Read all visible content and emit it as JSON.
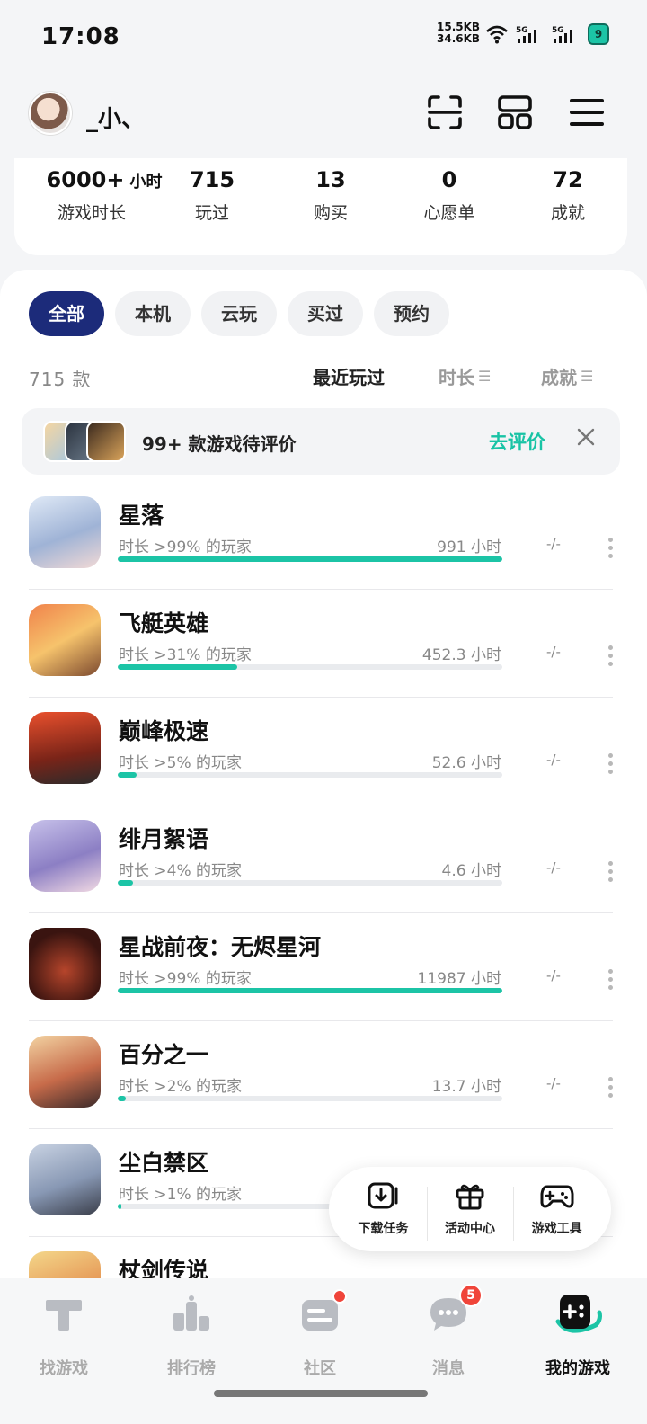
{
  "status_bar": {
    "time": "17:08",
    "net_up": "15.5KB",
    "net_down": "34.6KB",
    "battery": "9"
  },
  "profile": {
    "username": "_小、"
  },
  "stats": [
    {
      "value": "6000+",
      "unit": "小时",
      "label": "游戏时长"
    },
    {
      "value": "715",
      "unit": "",
      "label": "玩过"
    },
    {
      "value": "13",
      "unit": "",
      "label": "购买"
    },
    {
      "value": "0",
      "unit": "",
      "label": "心愿单"
    },
    {
      "value": "72",
      "unit": "",
      "label": "成就"
    }
  ],
  "filters": [
    "全部",
    "本机",
    "云玩",
    "买过",
    "预约"
  ],
  "list_header": {
    "count": "715 款",
    "sort_recent": "最近玩过",
    "sort_duration": "时长",
    "sort_achievement": "成就"
  },
  "review_banner": {
    "text": "99+ 款游戏待评价",
    "link": "去评价"
  },
  "games": [
    {
      "title": "星落",
      "pct": "时长 >99% 的玩家",
      "hours": "991 小时",
      "progress": 1.0,
      "score": "-/-"
    },
    {
      "title": "飞艇英雄",
      "pct": "时长 >31% 的玩家",
      "hours": "452.3 小时",
      "progress": 0.31,
      "score": "-/-"
    },
    {
      "title": "巅峰极速",
      "pct": "时长 >5% 的玩家",
      "hours": "52.6 小时",
      "progress": 0.05,
      "score": "-/-"
    },
    {
      "title": "绯月絮语",
      "pct": "时长 >4% 的玩家",
      "hours": "4.6 小时",
      "progress": 0.04,
      "score": "-/-"
    },
    {
      "title": "星战前夜：无烬星河",
      "pct": "时长 >99% 的玩家",
      "hours": "11987 小时",
      "progress": 1.0,
      "score": "-/-"
    },
    {
      "title": "百分之一",
      "pct": "时长 >2% 的玩家",
      "hours": "13.7 小时",
      "progress": 0.02,
      "score": "-/-"
    },
    {
      "title": "尘白禁区",
      "pct": "时长 >1% 的玩家",
      "hours": "",
      "progress": 0.01,
      "score": ""
    },
    {
      "title": "杖剑传说",
      "pct": "",
      "hours": "",
      "progress": 0,
      "score": ""
    }
  ],
  "float_tools": [
    "下载任务",
    "活动中心",
    "游戏工具"
  ],
  "bottom_nav": [
    {
      "label": "找游戏"
    },
    {
      "label": "排行榜"
    },
    {
      "label": "社区"
    },
    {
      "label": "消息",
      "badge": "5"
    },
    {
      "label": "我的游戏"
    }
  ],
  "colors": {
    "accent": "#1cc4a6",
    "active_tab": "#1c2b7a",
    "badge": "#f0453a"
  }
}
